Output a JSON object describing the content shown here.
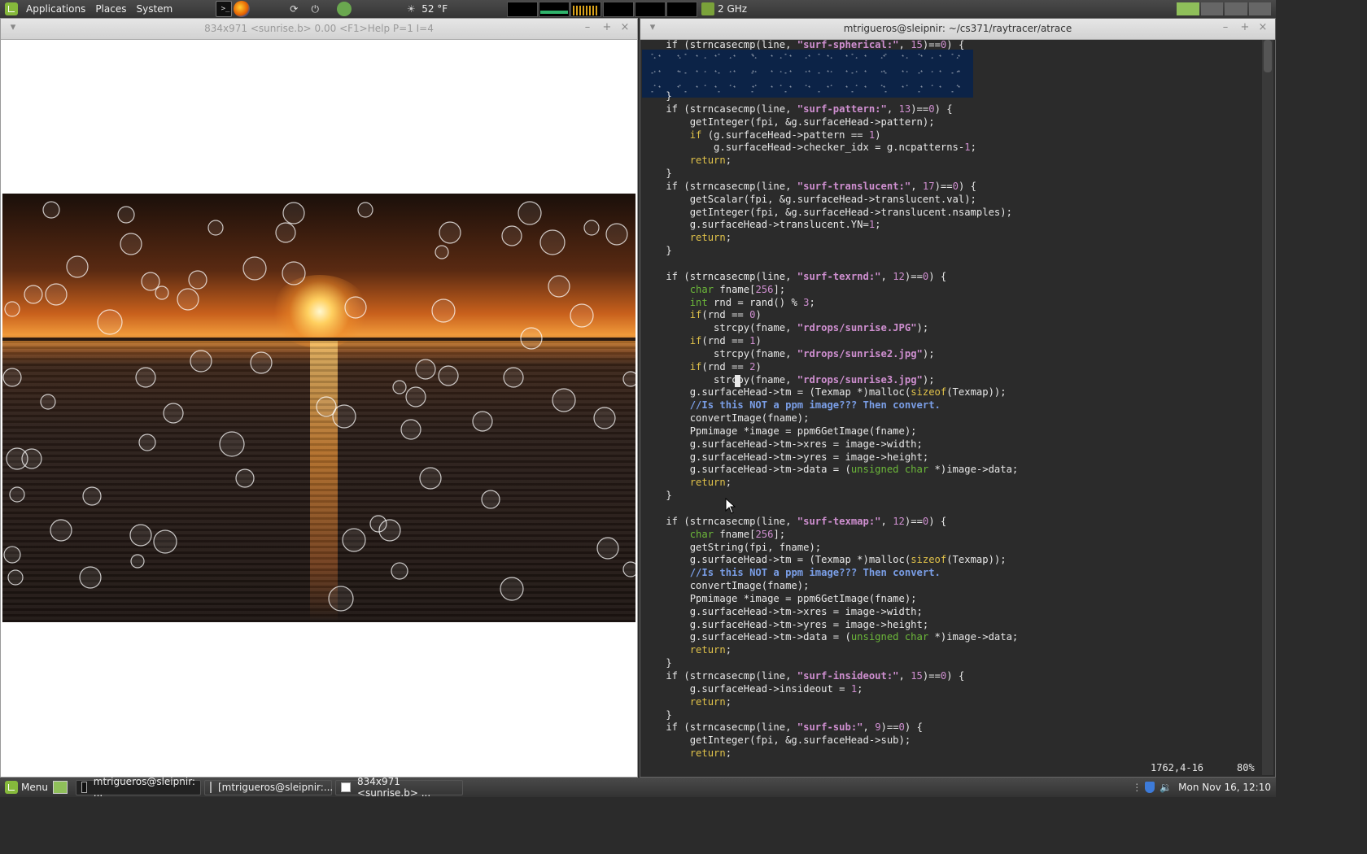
{
  "top_panel": {
    "menus": [
      "Applications",
      "Places",
      "System"
    ],
    "weather": "52 °F",
    "cpu_freq": "2 GHz"
  },
  "image_window": {
    "title": "834x971 <sunrise.b>  0.00 <F1>Help P=1 I=4"
  },
  "terminal_window": {
    "title": "mtrigueros@sleipnir: ~/cs371/raytracer/atrace",
    "status_pos": "1762,4-16",
    "status_pct": "80%"
  },
  "code": {
    "first": [
      [
        [
          "    if (strncasecmp(line, ",
          ""
        ],
        [
          "\"surf-spherical:\"",
          "st"
        ],
        [
          ", ",
          ""
        ],
        [
          "15",
          "nu"
        ],
        [
          ")==",
          ""
        ],
        [
          "0",
          "nu"
        ],
        [
          ") {",
          ""
        ]
      ]
    ],
    "lines": [
      [
        [
          "    }",
          ""
        ]
      ],
      [
        [
          "    if (strncasecmp(line, ",
          ""
        ],
        [
          "\"surf-pattern:\"",
          "st"
        ],
        [
          ", ",
          ""
        ],
        [
          "13",
          "nu"
        ],
        [
          ")==",
          ""
        ],
        [
          "0",
          "nu"
        ],
        [
          ") {",
          ""
        ]
      ],
      [
        [
          "        getInteger(fpi, &g.surfaceHead->pattern);",
          ""
        ]
      ],
      [
        [
          "        ",
          ""
        ],
        [
          "if",
          "kw"
        ],
        [
          " (g.surfaceHead->pattern == ",
          ""
        ],
        [
          "1",
          "nu"
        ],
        [
          ")",
          ""
        ]
      ],
      [
        [
          "            g.surfaceHead->checker_idx = g.ncpatterns-",
          ""
        ],
        [
          "1",
          "nu"
        ],
        [
          ";",
          ""
        ]
      ],
      [
        [
          "        ",
          ""
        ],
        [
          "return",
          "kw"
        ],
        [
          ";",
          ""
        ]
      ],
      [
        [
          "    }",
          ""
        ]
      ],
      [
        [
          "    if (strncasecmp(line, ",
          ""
        ],
        [
          "\"surf-translucent:\"",
          "st"
        ],
        [
          ", ",
          ""
        ],
        [
          "17",
          "nu"
        ],
        [
          ")==",
          ""
        ],
        [
          "0",
          "nu"
        ],
        [
          ") {",
          ""
        ]
      ],
      [
        [
          "        getScalar(fpi, &g.surfaceHead->translucent.val);",
          ""
        ]
      ],
      [
        [
          "        getInteger(fpi, &g.surfaceHead->translucent.nsamples);",
          ""
        ]
      ],
      [
        [
          "        g.surfaceHead->translucent.YN=",
          ""
        ],
        [
          "1",
          "nu"
        ],
        [
          ";",
          ""
        ]
      ],
      [
        [
          "        ",
          ""
        ],
        [
          "return",
          "kw"
        ],
        [
          ";",
          ""
        ]
      ],
      [
        [
          "    }",
          ""
        ]
      ],
      [
        [
          "",
          ""
        ]
      ],
      [
        [
          "    if (strncasecmp(line, ",
          ""
        ],
        [
          "\"surf-texrnd:\"",
          "st"
        ],
        [
          ", ",
          ""
        ],
        [
          "12",
          "nu"
        ],
        [
          ")==",
          ""
        ],
        [
          "0",
          "nu"
        ],
        [
          ") {",
          ""
        ]
      ],
      [
        [
          "        ",
          ""
        ],
        [
          "char",
          "ty"
        ],
        [
          " fname[",
          ""
        ],
        [
          "256",
          "nu"
        ],
        [
          "];",
          ""
        ]
      ],
      [
        [
          "        ",
          ""
        ],
        [
          "int",
          "ty"
        ],
        [
          " rnd = rand() % ",
          ""
        ],
        [
          "3",
          "nu"
        ],
        [
          ";",
          ""
        ]
      ],
      [
        [
          "        ",
          ""
        ],
        [
          "if",
          "kw"
        ],
        [
          "(rnd == ",
          ""
        ],
        [
          "0",
          "nu"
        ],
        [
          ")",
          ""
        ]
      ],
      [
        [
          "            strcpy(fname, ",
          ""
        ],
        [
          "\"rdrops/sunrise.JPG\"",
          "st"
        ],
        [
          ");",
          ""
        ]
      ],
      [
        [
          "        ",
          ""
        ],
        [
          "if",
          "kw"
        ],
        [
          "(rnd == ",
          ""
        ],
        [
          "1",
          "nu"
        ],
        [
          ")",
          ""
        ]
      ],
      [
        [
          "            strcpy(fname, ",
          ""
        ],
        [
          "\"rdrops/sunrise2.jpg\"",
          "st"
        ],
        [
          ");",
          ""
        ]
      ],
      [
        [
          "        ",
          ""
        ],
        [
          "if",
          "kw"
        ],
        [
          "(rnd == ",
          ""
        ],
        [
          "2",
          "nu"
        ],
        [
          ")",
          ""
        ]
      ],
      [
        [
          "            strcpy(fname, ",
          ""
        ],
        [
          "\"rdrops/sunrise3.jpg\"",
          "st"
        ],
        [
          ");",
          ""
        ]
      ],
      [
        [
          "        g.surfaceHead->tm = (Texmap *)malloc(",
          ""
        ],
        [
          "sizeof",
          "kw"
        ],
        [
          "(Texmap));",
          ""
        ]
      ],
      [
        [
          "        ",
          ""
        ],
        [
          "//Is this NOT a ppm image??? Then convert.",
          "cm"
        ]
      ],
      [
        [
          "        convertImage(fname);",
          ""
        ]
      ],
      [
        [
          "        Ppmimage *image = ppm6GetImage(fname);",
          ""
        ]
      ],
      [
        [
          "        g.surfaceHead->tm->xres = image->width;",
          ""
        ]
      ],
      [
        [
          "        g.surfaceHead->tm->yres = image->height;",
          ""
        ]
      ],
      [
        [
          "        g.surfaceHead->tm->data = (",
          ""
        ],
        [
          "unsigned char",
          "ty"
        ],
        [
          " *)image->data;",
          ""
        ]
      ],
      [
        [
          "        ",
          ""
        ],
        [
          "return",
          "kw"
        ],
        [
          ";",
          ""
        ]
      ],
      [
        [
          "    }",
          ""
        ]
      ],
      [
        [
          "",
          ""
        ]
      ],
      [
        [
          "    if (strncasecmp(line, ",
          ""
        ],
        [
          "\"surf-texmap:\"",
          "st"
        ],
        [
          ", ",
          ""
        ],
        [
          "12",
          "nu"
        ],
        [
          ")==",
          ""
        ],
        [
          "0",
          "nu"
        ],
        [
          ") {",
          ""
        ]
      ],
      [
        [
          "        ",
          ""
        ],
        [
          "char",
          "ty"
        ],
        [
          " fname[",
          ""
        ],
        [
          "256",
          "nu"
        ],
        [
          "];",
          ""
        ]
      ],
      [
        [
          "        getString(fpi, fname);",
          ""
        ]
      ],
      [
        [
          "        g.surfaceHead->tm = (Texmap *)malloc(",
          ""
        ],
        [
          "sizeof",
          "kw"
        ],
        [
          "(Texmap));",
          ""
        ]
      ],
      [
        [
          "        ",
          ""
        ],
        [
          "//Is this NOT a ppm image??? Then convert.",
          "cm"
        ]
      ],
      [
        [
          "        convertImage(fname);",
          ""
        ]
      ],
      [
        [
          "        Ppmimage *image = ppm6GetImage(fname);",
          ""
        ]
      ],
      [
        [
          "        g.surfaceHead->tm->xres = image->width;",
          ""
        ]
      ],
      [
        [
          "        g.surfaceHead->tm->yres = image->height;",
          ""
        ]
      ],
      [
        [
          "        g.surfaceHead->tm->data = (",
          ""
        ],
        [
          "unsigned char",
          "ty"
        ],
        [
          " *)image->data;",
          ""
        ]
      ],
      [
        [
          "        ",
          ""
        ],
        [
          "return",
          "kw"
        ],
        [
          ";",
          ""
        ]
      ],
      [
        [
          "    }",
          ""
        ]
      ],
      [
        [
          "    if (strncasecmp(line, ",
          ""
        ],
        [
          "\"surf-insideout:\"",
          "st"
        ],
        [
          ", ",
          ""
        ],
        [
          "15",
          "nu"
        ],
        [
          ")==",
          ""
        ],
        [
          "0",
          "nu"
        ],
        [
          ") {",
          ""
        ]
      ],
      [
        [
          "        g.surfaceHead->insideout = ",
          ""
        ],
        [
          "1",
          "nu"
        ],
        [
          ";",
          ""
        ]
      ],
      [
        [
          "        ",
          ""
        ],
        [
          "return",
          "kw"
        ],
        [
          ";",
          ""
        ]
      ],
      [
        [
          "    }",
          ""
        ]
      ],
      [
        [
          "    if (strncasecmp(line, ",
          ""
        ],
        [
          "\"surf-sub:\"",
          "st"
        ],
        [
          ", ",
          ""
        ],
        [
          "9",
          "nu"
        ],
        [
          ")==",
          ""
        ],
        [
          "0",
          "nu"
        ],
        [
          ") {",
          ""
        ]
      ],
      [
        [
          "        getInteger(fpi, &g.surfaceHead->sub);",
          ""
        ]
      ],
      [
        [
          "        ",
          ""
        ],
        [
          "return",
          "kw"
        ],
        [
          ";",
          ""
        ]
      ]
    ]
  },
  "bottom_panel": {
    "menu_label": "Menu",
    "tasks": [
      "mtrigueros@sleipnir: ...",
      "[mtrigueros@sleipnir:...",
      "834x971 <sunrise.b>  ..."
    ],
    "clock": "Mon Nov 16, 12:10"
  }
}
